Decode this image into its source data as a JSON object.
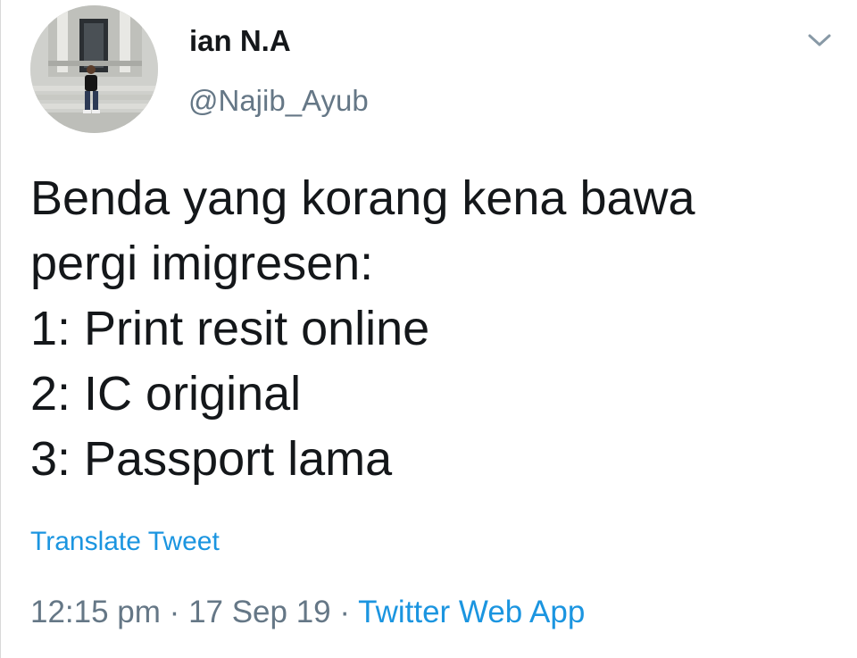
{
  "author": {
    "name": "ian N.A",
    "handle": "@Najib_Ayub"
  },
  "tweet": {
    "lines": [
      "Benda yang korang kena bawa",
      "pergi imigresen:",
      "1: Print resit online",
      "2: IC original",
      "3: Passport lama"
    ],
    "translate_label": "Translate Tweet"
  },
  "meta": {
    "time": "12:15 pm",
    "separator": "·",
    "date": "17 Sep 19",
    "source": "Twitter Web App"
  },
  "icons": {
    "caret": "chevron-down-icon",
    "avatar": "avatar"
  },
  "colors": {
    "link": "#1b95e0",
    "secondary_text": "#657786",
    "primary_text": "#14171a"
  }
}
